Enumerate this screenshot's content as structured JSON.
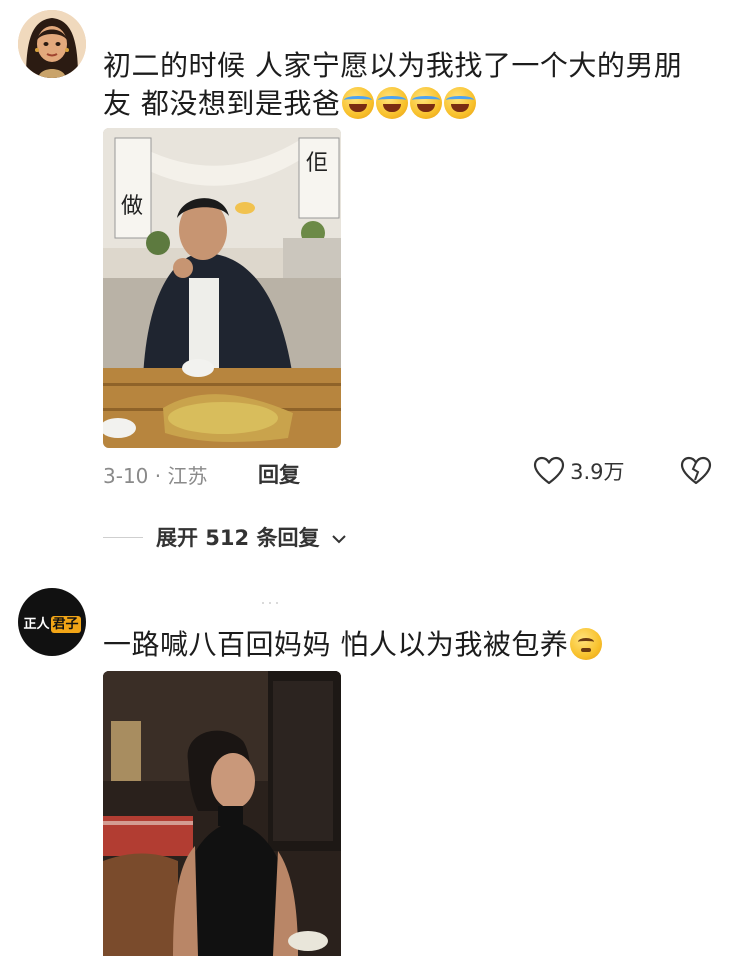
{
  "comments": [
    {
      "avatar": "girl-avatar",
      "text_line1": "初二的时候 人家宁愿以为我找了一个大的男朋",
      "text_line2": "友 都没想到是我爸",
      "emojis": [
        "laughing-tears-emoji",
        "laughing-tears-emoji",
        "laughing-tears-emoji",
        "laughing-tears-emoji"
      ],
      "photo": "man-at-restaurant-photo",
      "meta": "3-10 · 江苏",
      "reply_label": "回复",
      "likes": "3.9万",
      "expand_label": "展开 512 条回复"
    },
    {
      "avatar": "zhengren-junzi-logo",
      "avatar_text_a": "正人",
      "avatar_text_b": "君子",
      "text_line1": "一路喊八百回妈妈 怕人以为我被包养",
      "emojis": [
        "smirk-emoji"
      ],
      "photo": "woman-in-black-dress-photo"
    }
  ]
}
